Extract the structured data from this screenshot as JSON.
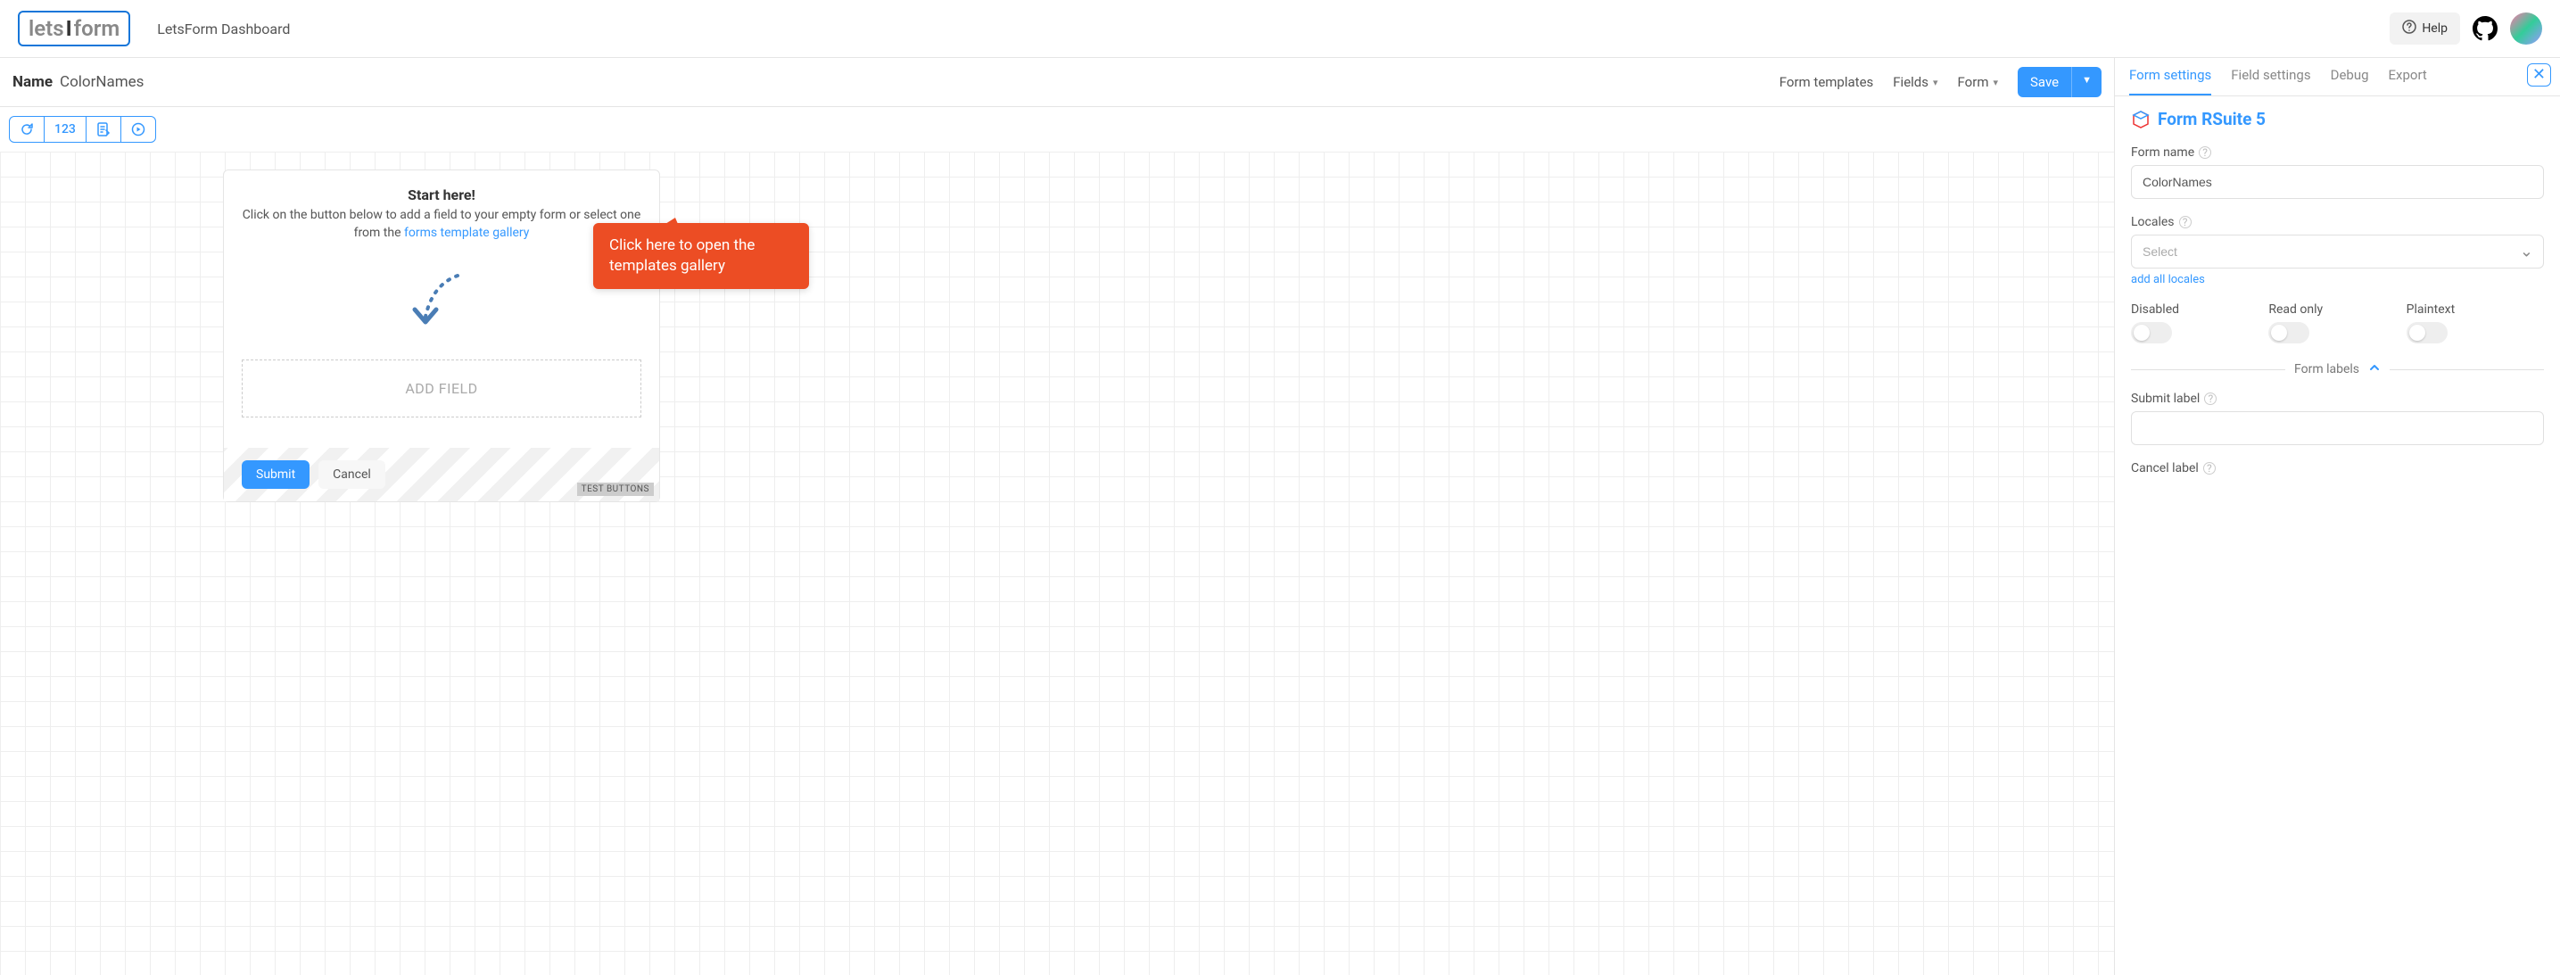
{
  "header": {
    "logo_text_left": "lets",
    "logo_text_right": "form",
    "title": "LetsForm Dashboard",
    "help_label": "Help"
  },
  "toolbar": {
    "name_label": "Name",
    "name_value": "ColorNames",
    "menu": {
      "templates": "Form templates",
      "fields": "Fields",
      "form": "Form"
    },
    "save_label": "Save"
  },
  "canvas": {
    "start_title": "Start here!",
    "start_text_1": "Click on the button below to add a field to your empty form or select one from the ",
    "start_link": "forms template gallery",
    "add_field": "ADD FIELD",
    "submit": "Submit",
    "cancel": "Cancel",
    "test_badge": "TEST BUTTONS"
  },
  "tooltip": {
    "text": "Click here to open the templates gallery"
  },
  "sidebar": {
    "tabs": {
      "form_settings": "Form settings",
      "field_settings": "Field settings",
      "debug": "Debug",
      "export": "Export"
    },
    "panel_title": "Form RSuite 5",
    "form_name_label": "Form name",
    "form_name_value": "ColorNames",
    "locales_label": "Locales",
    "locales_placeholder": "Select",
    "locales_hint": "add all locales",
    "disabled_label": "Disabled",
    "readonly_label": "Read only",
    "plaintext_label": "Plaintext",
    "form_labels_section": "Form labels",
    "submit_label": "Submit label",
    "cancel_label": "Cancel label"
  }
}
